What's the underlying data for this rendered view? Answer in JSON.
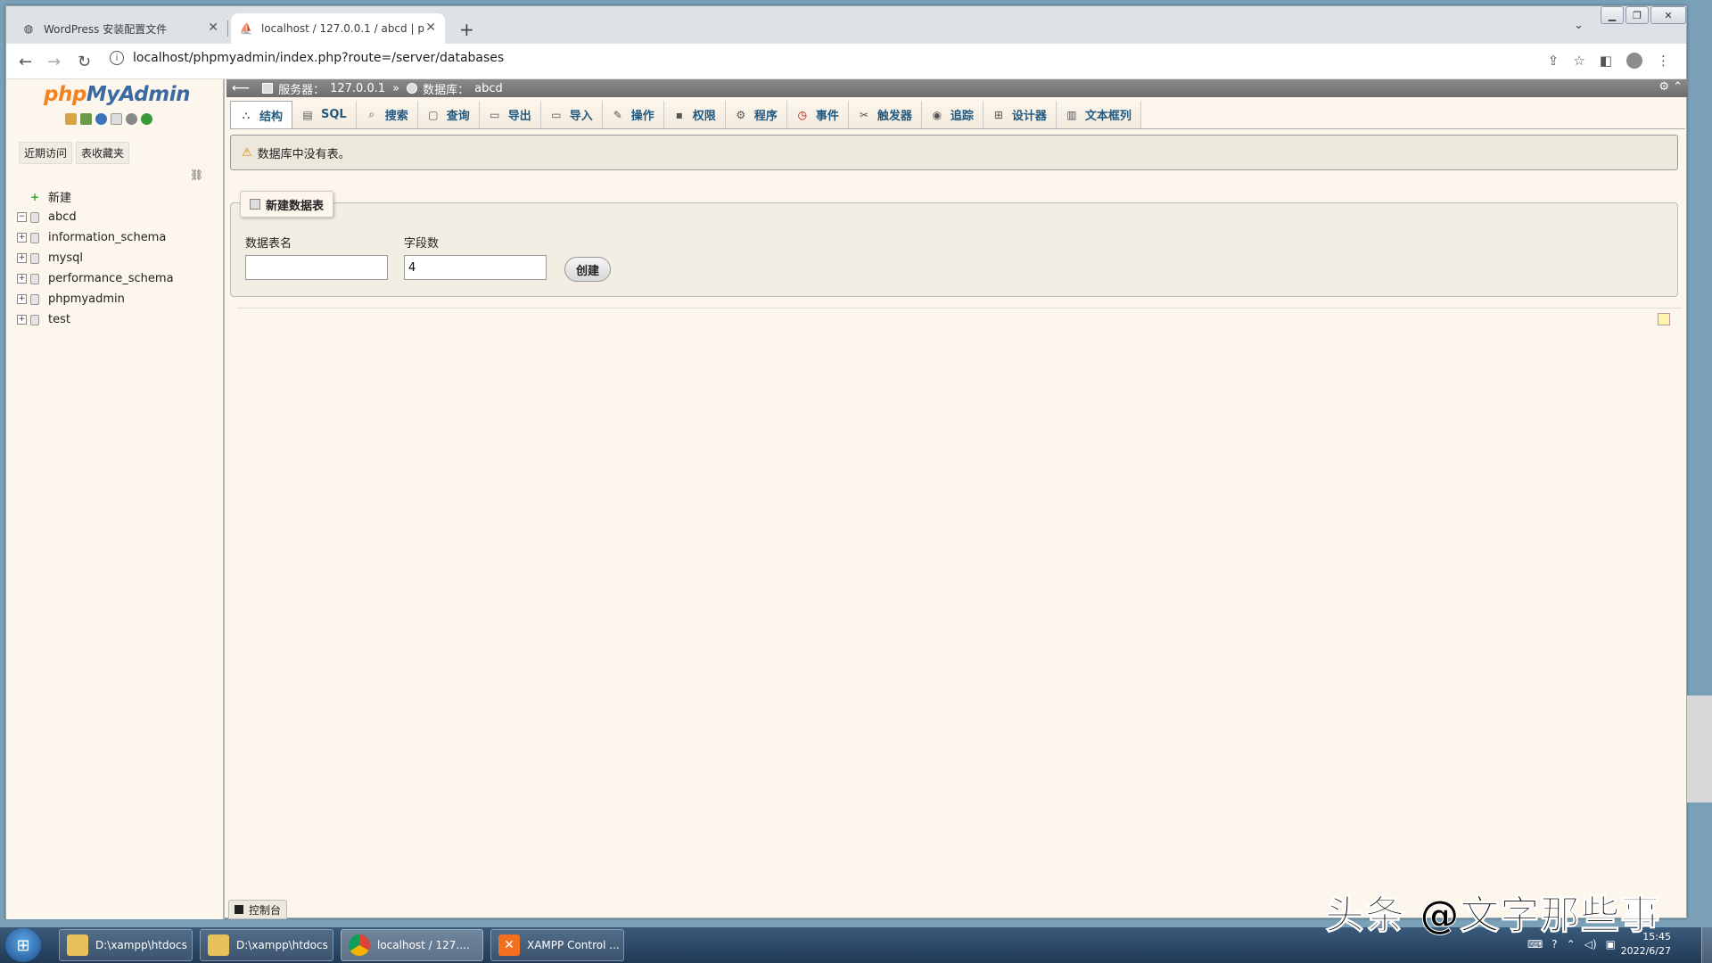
{
  "browser": {
    "tabs": [
      {
        "label": "WordPress 安装配置文件",
        "icon": "globe-icon"
      },
      {
        "label": "localhost / 127.0.0.1 / abcd | p",
        "icon": "phpmyadmin-icon"
      }
    ],
    "url": "localhost/phpmyadmin/index.php?route=/server/databases"
  },
  "sidebar": {
    "logo_php": "php",
    "logo_rest": "MyAdmin",
    "recent_label": "近期访问",
    "favorites_label": "表收藏夹",
    "tree": [
      {
        "label": "新建"
      },
      {
        "label": "abcd"
      },
      {
        "label": "information_schema"
      },
      {
        "label": "mysql"
      },
      {
        "label": "performance_schema"
      },
      {
        "label": "phpmyadmin"
      },
      {
        "label": "test"
      }
    ]
  },
  "breadcrumb": {
    "server_label": "服务器：",
    "server_value": "127.0.0.1",
    "sep": "»",
    "db_label": "数据库：",
    "db_value": "abcd"
  },
  "tabs": [
    "结构",
    "SQL",
    "搜索",
    "查询",
    "导出",
    "导入",
    "操作",
    "权限",
    "程序",
    "事件",
    "触发器",
    "追踪",
    "设计器",
    "文本框列"
  ],
  "notice": "数据库中没有表。",
  "create_table": {
    "legend": "新建数据表",
    "name_label": "数据表名",
    "name_value": "",
    "fields_label": "字段数",
    "fields_value": "4",
    "create_button": "创建"
  },
  "console_label": "控制台",
  "taskbar": {
    "items": [
      "D:\\xampp\\htdocs",
      "D:\\xampp\\htdocs",
      "localhost / 127....",
      "XAMPP Control ..."
    ],
    "time": "15:45",
    "date": "2022/6/27"
  },
  "watermark": "头条 @文字那些事"
}
